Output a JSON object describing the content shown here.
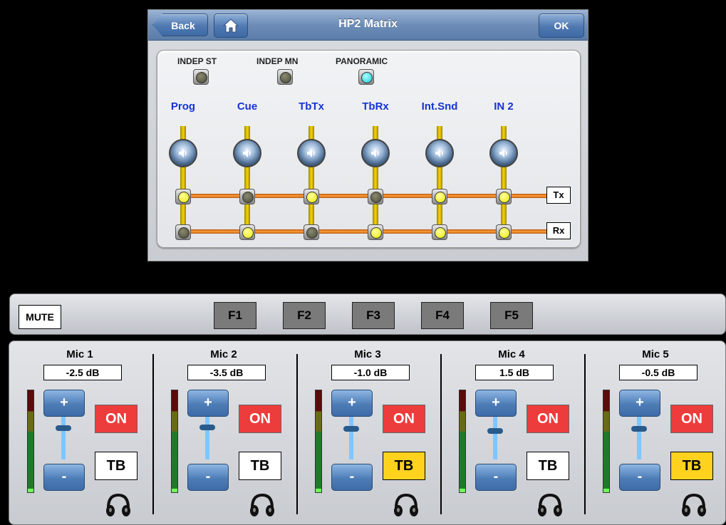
{
  "header": {
    "title": "HP2 Matrix",
    "back_label": "Back",
    "ok_label": "OK"
  },
  "modes": [
    {
      "label": "INDEP ST",
      "active": false
    },
    {
      "label": "INDEP MN",
      "active": false
    },
    {
      "label": "PANORAMIC",
      "active": true
    }
  ],
  "sources": [
    {
      "label": "Prog",
      "tx": true,
      "rx": false
    },
    {
      "label": "Cue",
      "tx": false,
      "rx": true
    },
    {
      "label": "TbTx",
      "tx": true,
      "rx": false
    },
    {
      "label": "TbRx",
      "tx": false,
      "rx": true
    },
    {
      "label": "Int.Snd",
      "tx": true,
      "rx": true
    },
    {
      "label": "IN 2",
      "tx": true,
      "rx": true
    }
  ],
  "bus_labels": {
    "tx": "Tx",
    "rx": "Rx"
  },
  "function_bar": {
    "mute_label": "MUTE",
    "buttons": [
      "F1",
      "F2",
      "F3",
      "F4",
      "F5"
    ]
  },
  "mics": [
    {
      "name": "Mic 1",
      "gain": "-2.5 dB",
      "on_label": "ON",
      "tb_label": "TB",
      "tb_active": false,
      "fader_level": 0.27,
      "plus": "+",
      "minus": "-"
    },
    {
      "name": "Mic 2",
      "gain": "-3.5 dB",
      "on_label": "ON",
      "tb_label": "TB",
      "tb_active": false,
      "fader_level": 0.25,
      "plus": "+",
      "minus": "-"
    },
    {
      "name": "Mic 3",
      "gain": "-1.0 dB",
      "on_label": "ON",
      "tb_label": "TB",
      "tb_active": true,
      "fader_level": 0.28,
      "plus": "+",
      "minus": "-"
    },
    {
      "name": "Mic 4",
      "gain": "1.5 dB",
      "on_label": "ON",
      "tb_label": "TB",
      "tb_active": false,
      "fader_level": 0.34,
      "plus": "+",
      "minus": "-"
    },
    {
      "name": "Mic 5",
      "gain": "-0.5 dB",
      "on_label": "ON",
      "tb_label": "TB",
      "tb_active": true,
      "fader_level": 0.29,
      "plus": "+",
      "minus": "-"
    }
  ],
  "colors": {
    "accent_blue": "#1533d6",
    "on_red": "#ec3c3c",
    "tb_yellow": "#ffd21e",
    "led_cyan": "#19c8d8",
    "led_yellow": "#e8e800"
  }
}
